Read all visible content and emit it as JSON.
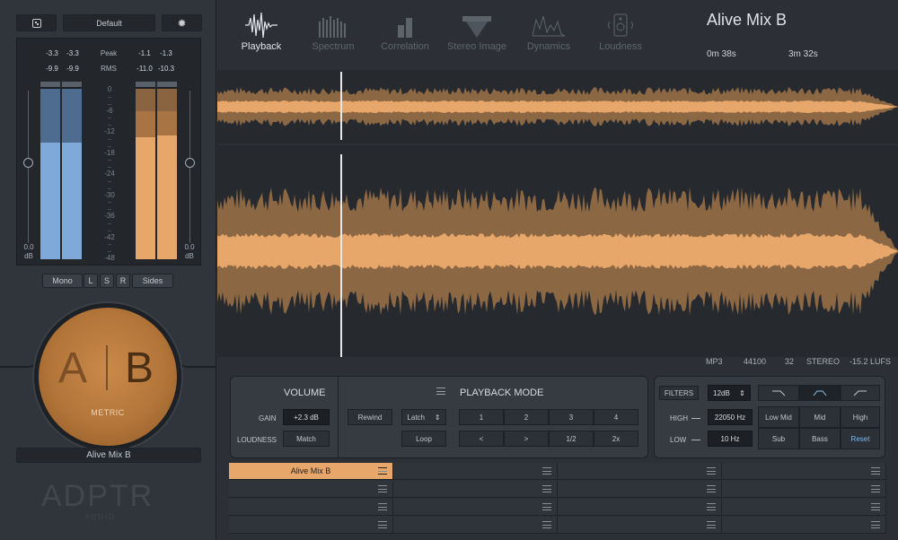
{
  "left": {
    "preset": "Default",
    "peak_label": "Peak",
    "rms_label": "RMS",
    "peak_a": [
      "-3.3",
      "-3.3"
    ],
    "rms_a": [
      "-9.9",
      "-9.9"
    ],
    "peak_b": [
      "-1.1",
      "-1.3"
    ],
    "rms_b": [
      "-11.0",
      "-10.3"
    ],
    "scale": [
      "0",
      "-6",
      "-12",
      "-18",
      "-24",
      "-30",
      "-36",
      "-42",
      "-48"
    ],
    "fader_a": {
      "value": "0.0",
      "unit": "dB"
    },
    "fader_b": {
      "value": "0.0",
      "unit": "dB"
    },
    "modes": [
      "Mono",
      "L",
      "S",
      "R",
      "Sides"
    ],
    "ab_a": "A",
    "ab_b": "B",
    "ab_sub": "METRIC",
    "track_name": "Alive Mix B",
    "logo": "ADPTR",
    "logo_sub": "AUDIO"
  },
  "tabs": [
    {
      "label": "Playback",
      "icon": "waveform-icon"
    },
    {
      "label": "Spectrum",
      "icon": "spectrum-icon"
    },
    {
      "label": "Correlation",
      "icon": "correlation-icon"
    },
    {
      "label": "Stereo Image",
      "icon": "stereo-image-icon"
    },
    {
      "label": "Dynamics",
      "icon": "dynamics-icon"
    },
    {
      "label": "Loudness",
      "icon": "speaker-icon"
    }
  ],
  "header": {
    "title": "Alive Mix B",
    "position": "0m 38s",
    "duration": "3m 32s"
  },
  "fileinfo": {
    "format": "MP3",
    "rate": "44100",
    "bits": "32",
    "channels": "STEREO",
    "lufs": "-15.2 LUFS"
  },
  "volume": {
    "title": "VOLUME",
    "gain_label": "GAIN",
    "gain": "+2.3 dB",
    "loud_label": "LOUDNESS",
    "match": "Match"
  },
  "playback": {
    "title": "PLAYBACK MODE",
    "rewind": "Rewind",
    "latch": "Latch",
    "loop": "Loop",
    "nums": [
      "1",
      "2",
      "3",
      "4"
    ],
    "prev": "<",
    "next": ">",
    "half": "1/2",
    "double": "2x"
  },
  "filters": {
    "label": "FILTERS",
    "slope": "12dB",
    "high_label": "HIGH",
    "high": "22050 Hz",
    "low_label": "LOW",
    "low": "10 Hz",
    "bands": [
      "Low Mid",
      "Mid",
      "High",
      "Sub",
      "Bass",
      "Reset"
    ]
  },
  "slots": [
    [
      "Alive Mix B",
      "",
      "",
      ""
    ],
    [
      "",
      "",
      "",
      ""
    ],
    [
      "",
      "",
      "",
      ""
    ],
    [
      "",
      "",
      "",
      ""
    ]
  ],
  "colors": {
    "accent": "#e7a66a",
    "blue": "#7ea9d8",
    "bg": "#2b2f35"
  }
}
